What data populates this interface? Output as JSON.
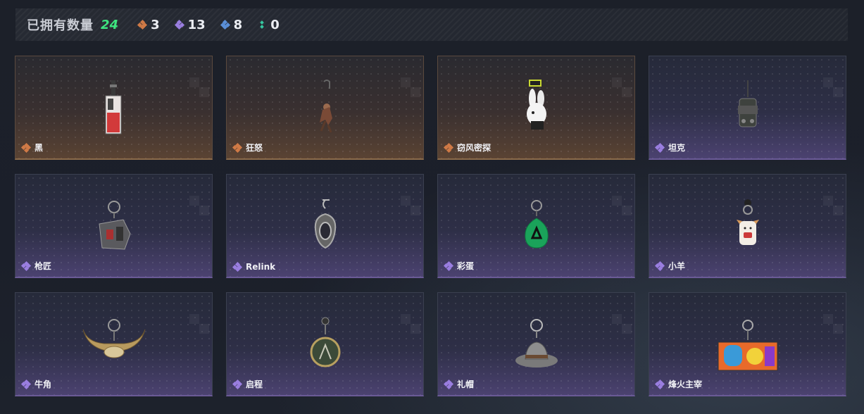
{
  "header": {
    "owned_label": "已拥有数量",
    "owned_total": "24",
    "counts": [
      {
        "tier": "orange",
        "value": "3"
      },
      {
        "tier": "purple",
        "value": "13"
      },
      {
        "tier": "blue",
        "value": "8"
      },
      {
        "tier": "teal",
        "value": "0"
      }
    ]
  },
  "colors": {
    "orange": "#d07a46",
    "purple": "#9a7ee0",
    "blue": "#5a8fd8",
    "teal": "#36c7a0",
    "total": "#3ee47f"
  },
  "items": [
    {
      "name": "黑",
      "tier": "orange",
      "icon": "card-charm-icon"
    },
    {
      "name": "狂怒",
      "tier": "orange",
      "icon": "figure-charm-icon"
    },
    {
      "name": "窃风密探",
      "tier": "orange",
      "icon": "rabbit-charm-icon"
    },
    {
      "name": "坦克",
      "tier": "purple",
      "icon": "tank-charm-icon"
    },
    {
      "name": "枪匠",
      "tier": "purple",
      "icon": "gunsmith-charm-icon"
    },
    {
      "name": "Relink",
      "tier": "purple",
      "icon": "relink-charm-icon"
    },
    {
      "name": "彩蛋",
      "tier": "purple",
      "icon": "green-egg-charm-icon"
    },
    {
      "name": "小羊",
      "tier": "purple",
      "icon": "lamb-charm-icon"
    },
    {
      "name": "牛角",
      "tier": "purple",
      "icon": "horns-charm-icon"
    },
    {
      "name": "启程",
      "tier": "purple",
      "icon": "medal-charm-icon"
    },
    {
      "name": "礼帽",
      "tier": "purple",
      "icon": "hat-charm-icon"
    },
    {
      "name": "烽火主宰",
      "tier": "purple",
      "icon": "graffiti-charm-icon"
    }
  ]
}
